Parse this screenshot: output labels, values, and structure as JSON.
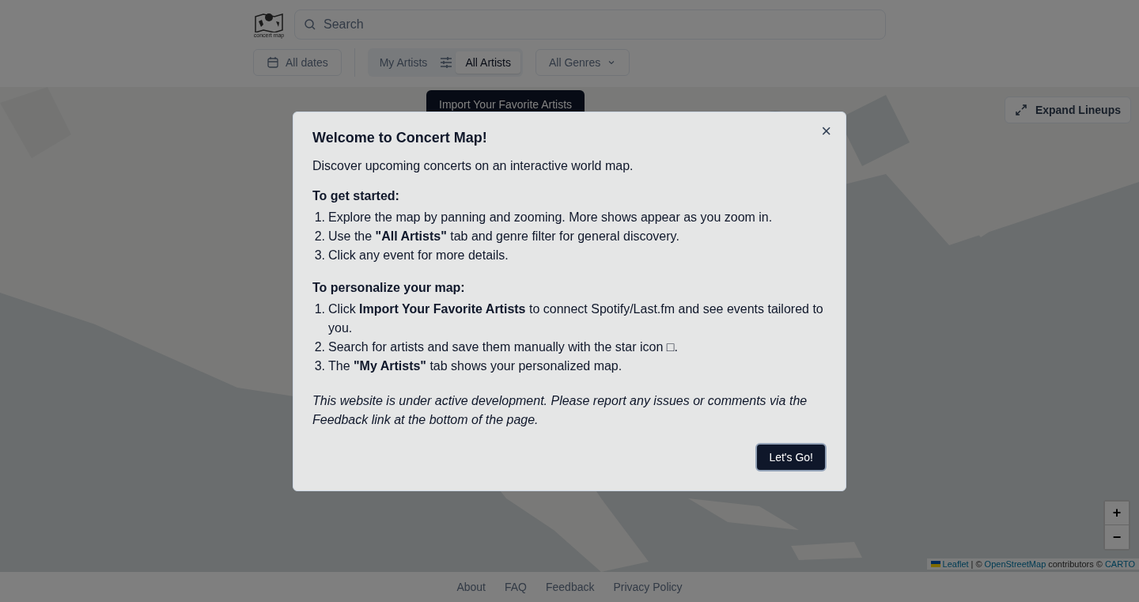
{
  "header": {
    "logo_text": "concert map",
    "search": {
      "placeholder": "Search"
    },
    "date_filter": "All dates",
    "tabs": [
      {
        "label": "My Artists",
        "selected": false
      },
      {
        "label": "All Artists",
        "selected": true
      }
    ],
    "genre_filter": "All Genres"
  },
  "map": {
    "import_button": "Import Your Favorite Artists",
    "expand_button": "Expand Lineups",
    "zoom_in": "+",
    "zoom_out": "−",
    "attribution": {
      "leaflet": "Leaflet",
      "separator": "| ©",
      "osm": "OpenStreetMap",
      "contributors": "contributors ©",
      "carto": "CARTO"
    }
  },
  "footer": {
    "links": [
      "About",
      "FAQ",
      "Feedback",
      "Privacy Policy"
    ]
  },
  "modal": {
    "title": "Welcome to Concert Map!",
    "close": "×",
    "intro": "Discover upcoming concerts on an interactive world map.",
    "sections": [
      {
        "heading": "To get started:",
        "steps": [
          {
            "marker": "1.",
            "text": "Explore the map by panning and zooming. More shows appear as you zoom in."
          },
          {
            "marker": "2.",
            "text": "Use the **\"All Artists\"** tab and genre filter for general discovery."
          },
          {
            "marker": "3.",
            "text": "Click any event for more details."
          }
        ]
      },
      {
        "heading": "To personalize your map:",
        "steps": [
          {
            "marker": "1.",
            "text": "Click **Import Your Favorite Artists** to connect Spotify/Last.fm and see events tailored to you."
          },
          {
            "marker": "2.",
            "text": "Search for artists and save them manually with the star icon □."
          },
          {
            "marker": "3.",
            "text": "The **\"My Artists\"** tab shows your personalized map."
          }
        ]
      }
    ],
    "note": "This website is under active development. Please report any issues or comments via the Feedback link at the bottom of the page.",
    "button": "Let's Go!"
  }
}
